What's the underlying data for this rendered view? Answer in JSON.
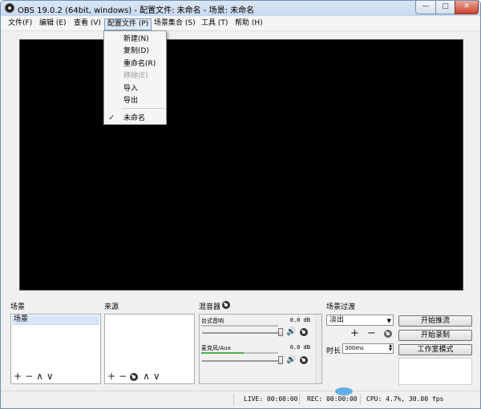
{
  "window": {
    "title": "OBS 19.0.2 (64bit, windows) - 配置文件: 未命名 - 场景: 未命名",
    "controls": {
      "minimize": "—",
      "maximize": "□",
      "close": "✕"
    }
  },
  "menubar": {
    "items": [
      "文件(F)",
      "编辑 (E)",
      "查看 (V)",
      "配置文件 (P)",
      "场景集合 (S)",
      "工具 (T)",
      "帮助 (H)"
    ]
  },
  "profile_menu": {
    "items": [
      {
        "label": "新建(N)",
        "enabled": true
      },
      {
        "label": "复制(D)",
        "enabled": true
      },
      {
        "label": "重命名(R)",
        "enabled": true
      },
      {
        "label": "移除(E)",
        "enabled": false
      },
      {
        "label": "导入",
        "enabled": true
      },
      {
        "label": "导出",
        "enabled": true
      }
    ],
    "checked_item": "未命名",
    "check_mark": "✓"
  },
  "scenes": {
    "title": "场景",
    "items": [
      "场景"
    ],
    "tools": [
      "+",
      "−",
      "∧",
      "∨"
    ]
  },
  "sources": {
    "title": "来源",
    "items": [],
    "tools": [
      "+",
      "−",
      "∧",
      "∨"
    ]
  },
  "mixer": {
    "title": "混音器",
    "tracks": [
      {
        "name": "台式音响",
        "db": "0.0 dB",
        "level": 0
      },
      {
        "name": "麦克风/Aux",
        "db": "0.0 dB",
        "level": 0.55
      }
    ],
    "speaker_glyph": "🔊"
  },
  "transitions": {
    "title": "场景过渡",
    "selected": "淡出",
    "tools": [
      "+",
      "−"
    ],
    "duration_label": "时长",
    "duration_value": "300ms"
  },
  "controls": {
    "start_streaming": "开始推流",
    "start_recording": "开始录制",
    "studio_mode": "工作室模式"
  },
  "status": {
    "live": "LIVE: 00:00:00",
    "rec": "REC: 00:00:00",
    "cpu": "CPU: 4.7%, 30.00 fps"
  },
  "colors": {
    "meter_green": "#4caf50",
    "preview_bg": "#000000"
  }
}
